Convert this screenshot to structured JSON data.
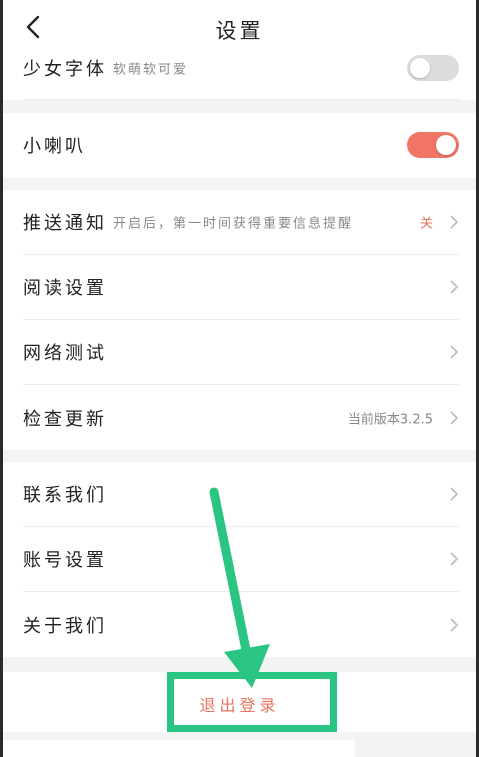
{
  "header": {
    "title": "设置",
    "back_icon": "chevron-left-icon"
  },
  "group1": {
    "items": [
      {
        "label": "少女字体",
        "subtitle": "软萌软可爱",
        "toggle": "off"
      },
      {
        "label": "小喇叭",
        "toggle": "on"
      }
    ]
  },
  "group2": {
    "items": [
      {
        "label": "推送通知",
        "subtitle": "开启后，第一时间获得重要信息提醒",
        "value": "关"
      },
      {
        "label": "阅读设置"
      },
      {
        "label": "网络测试"
      },
      {
        "label": "检查更新",
        "value": "当前版本3.2.5"
      }
    ]
  },
  "group3": {
    "items": [
      {
        "label": "联系我们"
      },
      {
        "label": "账号设置"
      },
      {
        "label": "关于我们"
      }
    ]
  },
  "logout": {
    "label": "退出登录"
  },
  "colors": {
    "accent": "#f07565",
    "toggle_off": "#dcdcdc",
    "annotation": "#2ac483",
    "text_red": "#e8735f"
  }
}
